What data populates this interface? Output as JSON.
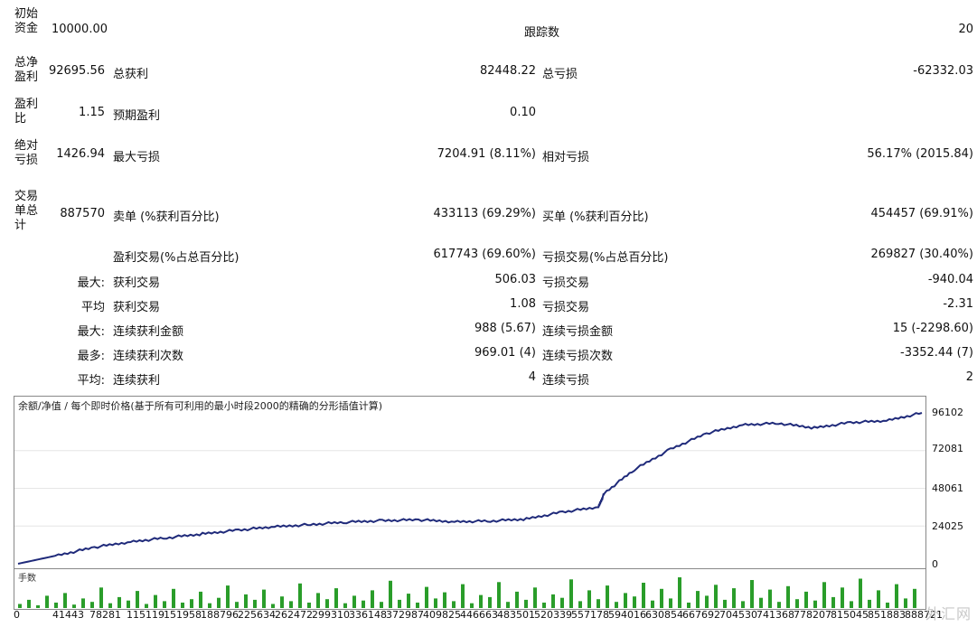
{
  "stats": {
    "row1": {
      "label": "初始资金",
      "value": "10000.00",
      "mid_label": "跟踪数",
      "right_value": "20"
    },
    "row2": {
      "label": "总净盈利",
      "value": "92695.56",
      "label2": "总获利",
      "value2": "82448.22",
      "label3": "总亏损",
      "value3": "-62332.03"
    },
    "row3": {
      "label": "盈利比",
      "value": "1.15",
      "label2": "预期盈利",
      "value2": "0.10"
    },
    "row4": {
      "label": "绝对亏损",
      "value": "1426.94",
      "label2": "最大亏损",
      "value2": "7204.91 (8.11%)",
      "label3": "相对亏损",
      "value3": "56.17% (2015.84)"
    },
    "row5": {
      "label": "交易单总计",
      "value": "887570",
      "label2": "卖单 (%获利百分比)",
      "value2": "433113 (69.29%)",
      "label3": "买单 (%获利百分比)",
      "value3": "454457 (69.91%)"
    },
    "row6": {
      "label2": "盈利交易(%占总百分比)",
      "value2": "617743 (69.60%)",
      "label3": "亏损交易(%占总百分比)",
      "value3": "269827 (30.40%)"
    },
    "row7": {
      "sub": "最大:",
      "label2": "获利交易",
      "value2": "506.03",
      "label3": "亏损交易",
      "value3": "-940.04"
    },
    "row8": {
      "sub": "平均",
      "label2": "获利交易",
      "value2": "1.08",
      "label3": "亏损交易",
      "value3": "-2.31"
    },
    "row9": {
      "sub": "最大:",
      "label2": "连续获利金额",
      "value2": "988 (5.67)",
      "label3": "连续亏损金额",
      "value3": "15 (-2298.60)"
    },
    "row10": {
      "sub": "最多:",
      "label2": "连续获利次数",
      "value2": "969.01 (4)",
      "label3": "连续亏损次数",
      "value3": "-3352.44 (7)"
    },
    "row11": {
      "sub": "平均:",
      "label2": "连续获利",
      "value2": "4",
      "label3": "连续亏损",
      "value3": "2"
    }
  },
  "chart": {
    "title": "余额/净值 / 每个即时价格(基于所有可利用的最小时段2000的精确的分形插值计算)",
    "volume_label": "手数",
    "watermark": "外汇网",
    "y_ticks": [
      "96102",
      "72081",
      "48061",
      "24025",
      "0"
    ],
    "x_ticks": [
      "0",
      "41443",
      "78281",
      "115119",
      "151958",
      "188796",
      "225634",
      "262472",
      "299310",
      "336148",
      "372987",
      "409825",
      "446663",
      "483501",
      "520339",
      "557178",
      "594016",
      "630854",
      "667692",
      "704530",
      "741368",
      "778207",
      "815045",
      "851883",
      "888721"
    ]
  },
  "chart_data": {
    "type": "line",
    "title": "余额/净值 / 每个即时价格(基于所有可利用的最小时段2000的精确的分形插值计算)",
    "xlabel": "",
    "ylabel": "",
    "ylim": [
      0,
      96102
    ],
    "xlim": [
      0,
      888721
    ],
    "grid": true,
    "series": [
      {
        "name": "余额/净值",
        "color": "#1f2a7a",
        "x": [
          0,
          41443,
          78281,
          115119,
          151958,
          188796,
          225634,
          262472,
          299310,
          336148,
          372987,
          409825,
          446663,
          483501,
          520339,
          557178,
          594016,
          600000,
          630854,
          667692,
          704530,
          741368,
          778207,
          815045,
          851883,
          888721,
          925000
        ],
        "y": [
          0,
          5500,
          10500,
          14000,
          16500,
          19000,
          21500,
          23500,
          25000,
          26500,
          27500,
          28000,
          26800,
          27200,
          28500,
          33000,
          36000,
          45000,
          60000,
          73000,
          83000,
          88500,
          89500,
          86500,
          90000,
          91000,
          96102
        ]
      }
    ],
    "volume": {
      "color": "#2a9d2a",
      "values": [
        6,
        12,
        4,
        18,
        8,
        22,
        5,
        14,
        9,
        30,
        7,
        16,
        11,
        25,
        6,
        19,
        10,
        28,
        8,
        13,
        24,
        7,
        15,
        33,
        9,
        20,
        12,
        27,
        6,
        17,
        10,
        36,
        8,
        22,
        13,
        29,
        7,
        18,
        11,
        26,
        9,
        40,
        12,
        21,
        8,
        31,
        14,
        23,
        10,
        35,
        7,
        19,
        16,
        38,
        9,
        24,
        12,
        30,
        8,
        20,
        15,
        42,
        10,
        26,
        13,
        33,
        9,
        22,
        17,
        37,
        11,
        28,
        14,
        45,
        8,
        25,
        18,
        34,
        12,
        29,
        10,
        41,
        15,
        27,
        9,
        32,
        13,
        24,
        11,
        38,
        16,
        30,
        10,
        43,
        12,
        26,
        8,
        35,
        14,
        28
      ]
    }
  }
}
